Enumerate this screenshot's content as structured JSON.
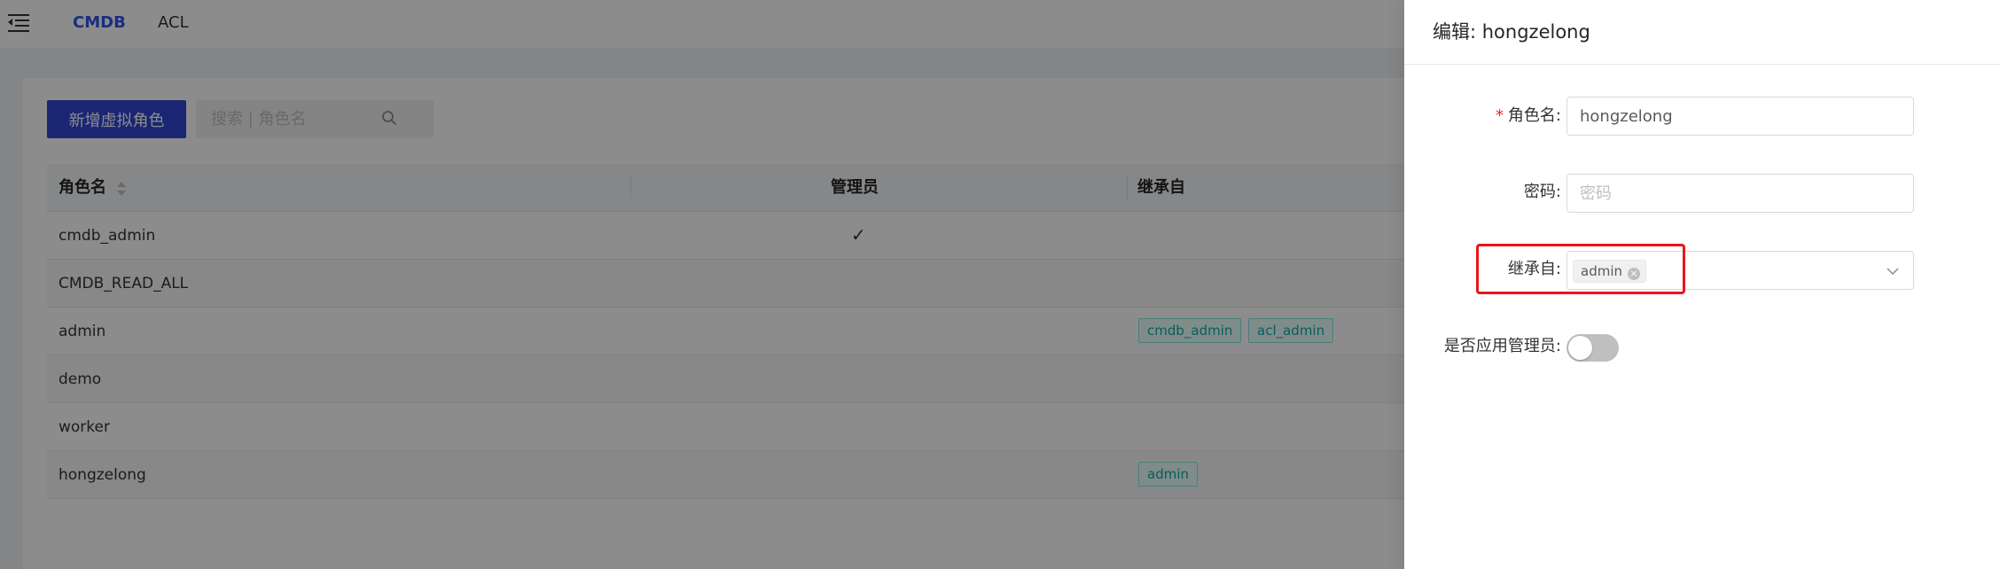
{
  "topbar": {
    "nav": [
      {
        "label": "CMDB",
        "active": true
      },
      {
        "label": "ACL",
        "active": false
      }
    ]
  },
  "toolbar": {
    "add_button_label": "新增虚拟角色",
    "search_placeholder": "搜索 | 角色名"
  },
  "table": {
    "columns": [
      "角色名",
      "管理员",
      "继承自"
    ],
    "rows": [
      {
        "name": "cmdb_admin",
        "is_admin": true,
        "inherits": []
      },
      {
        "name": "CMDB_READ_ALL",
        "is_admin": false,
        "inherits": []
      },
      {
        "name": "admin",
        "is_admin": false,
        "inherits": [
          "cmdb_admin",
          "acl_admin"
        ]
      },
      {
        "name": "demo",
        "is_admin": false,
        "inherits": []
      },
      {
        "name": "worker",
        "is_admin": false,
        "inherits": []
      },
      {
        "name": "hongzelong",
        "is_admin": false,
        "inherits": [
          "admin"
        ]
      }
    ],
    "check_glyph": "✓"
  },
  "drawer": {
    "title": "编辑: hongzelong",
    "fields": {
      "role_name": {
        "required_mark": "*",
        "label": "角色名:",
        "value": "hongzelong"
      },
      "password": {
        "label": "密码:",
        "placeholder": "密码"
      },
      "inherits": {
        "label": "继承自:",
        "selected": [
          "admin"
        ],
        "remove_glyph": "×"
      },
      "is_app_admin": {
        "label": "是否应用管理员:",
        "checked": false
      }
    }
  },
  "colors": {
    "primary": "#3146d4",
    "tag_text": "#13a8a8",
    "highlight": "#e8161b"
  }
}
